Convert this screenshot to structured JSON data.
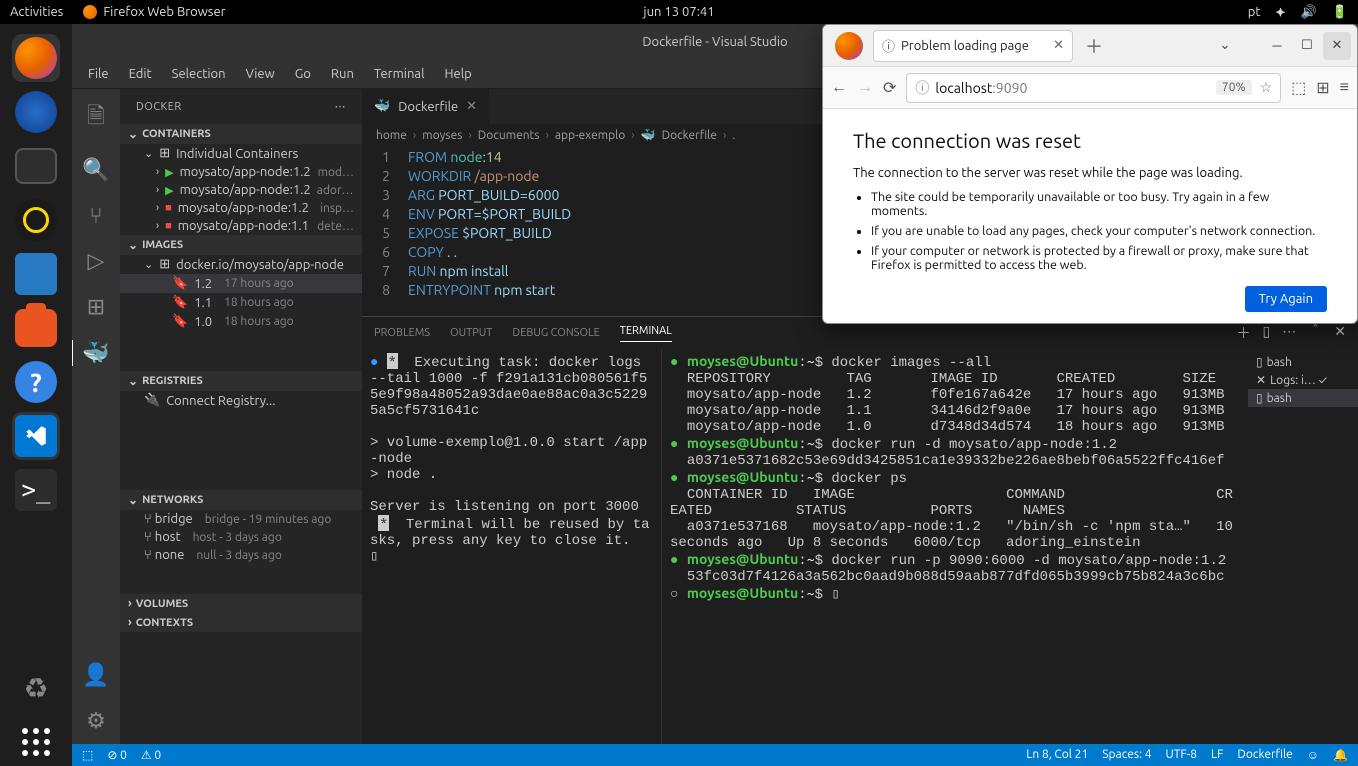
{
  "gnome": {
    "activities": "Activities",
    "app": "Firefox Web Browser",
    "clock": "jun 13  07:41",
    "lang": "pt"
  },
  "vscode": {
    "title": "Dockerfile - Visual Studio",
    "menu": [
      "File",
      "Edit",
      "Selection",
      "View",
      "Go",
      "Run",
      "Terminal",
      "Help"
    ],
    "docker_panel": {
      "title": "DOCKER",
      "sections": {
        "containers": "CONTAINERS",
        "individual": "Individual Containers",
        "images": "IMAGES",
        "registries": "REGISTRIES",
        "networks": "NETWORKS",
        "volumes": "VOLUMES",
        "contexts": "CONTEXTS"
      },
      "containers": [
        {
          "name": "moysato/app-node:1.2",
          "desc": "mod…",
          "running": true
        },
        {
          "name": "moysato/app-node:1.2",
          "desc": "adori…",
          "running": true
        },
        {
          "name": "moysato/app-node:1.2",
          "desc": "insp…",
          "running": false
        },
        {
          "name": "moysato/app-node:1.1",
          "desc": "dete…",
          "running": false
        }
      ],
      "image_repo": "docker.io/moysato/app-node",
      "image_tags": [
        {
          "tag": "1.2",
          "age": "17 hours ago",
          "selected": true
        },
        {
          "tag": "1.1",
          "age": "18 hours ago"
        },
        {
          "tag": "1.0",
          "age": "18 hours ago"
        }
      ],
      "connect_registry": "Connect Registry...",
      "networks": [
        {
          "name": "bridge",
          "desc": "bridge - 19 minutes ago"
        },
        {
          "name": "host",
          "desc": "host - 3 days ago"
        },
        {
          "name": "none",
          "desc": "null - 3 days ago"
        }
      ]
    },
    "tab": {
      "name": "Dockerfile"
    },
    "breadcrumb": [
      "home",
      "moyses",
      "Documents",
      "app-exemplo",
      "Dockerfile",
      "."
    ],
    "code_lines": [
      {
        "n": "1",
        "html": "<span class='kw'>FROM</span> <span class='fn'>node</span><span class='op'>:</span><span class='num'>14</span>"
      },
      {
        "n": "2",
        "html": "<span class='kw'>WORKDIR</span> <span class='txt'>/app-node</span>"
      },
      {
        "n": "3",
        "html": "<span class='kw'>ARG</span> <span class='var'>PORT_BUILD=6000</span>"
      },
      {
        "n": "4",
        "html": "<span class='kw'>ENV</span> <span class='var'>PORT=$PORT_BUILD</span>"
      },
      {
        "n": "5",
        "html": "<span class='kw'>EXPOSE</span> <span class='var'>$PORT_BUILD</span>"
      },
      {
        "n": "6",
        "html": "<span class='kw'>COPY</span> <span class='op'>. .</span>"
      },
      {
        "n": "7",
        "html": "<span class='kw'>RUN</span> <span class='var'>npm</span> <span class='var'>install</span>"
      },
      {
        "n": "8",
        "html": "<span class='kw'>ENTRYPOINT</span> <span class='var'>npm</span> <span class='var'>start</span>"
      }
    ],
    "panel_tabs": [
      "PROBLEMS",
      "OUTPUT",
      "DEBUG CONSOLE",
      "TERMINAL"
    ],
    "term_left": "<span class='bullet-blue'>●</span> <span class='inv'>*</span>  Executing task: docker logs --tail 1000 -f f291a131cb080561f55e9f98a48052a93dae0ae88ac0a3c52295a5cf5731641c \n\n> volume-exemplo@1.0.0 start /app-node\n> node .\n\nServer is listening on port 3000\n <span class='inv'>*</span>  Terminal will be reused by tasks, press any key to close it.\n▯",
    "term_right": "<span class='bullet-green'>●</span> <span class='prompt-user'>moyses@Ubuntu</span>:<span class='prompt-path'>~</span>$ docker images --all\n  REPOSITORY         TAG       IMAGE ID       CREATED        SIZE\n  moysato/app-node   1.2       f0fe167a642e   17 hours ago   913MB\n  moysato/app-node   1.1       34146d2f9a0e   17 hours ago   913MB\n  moysato/app-node   1.0       d7348d34d574   18 hours ago   913MB\n<span class='bullet-green'>●</span> <span class='prompt-user'>moyses@Ubuntu</span>:<span class='prompt-path'>~</span>$ docker run -d moysato/app-node:1.2\n  a0371e5371682c53e69dd3425851ca1e39332be226ae8bebf06a5522ffc416ef\n<span class='bullet-green'>●</span> <span class='prompt-user'>moyses@Ubuntu</span>:<span class='prompt-path'>~</span>$ docker ps\n  CONTAINER ID   IMAGE                  COMMAND                  CREATED          STATUS          PORTS      NAMES\n  a0371e537168   moysato/app-node:1.2   \"/bin/sh -c 'npm sta…\"   10 seconds ago   Up 8 seconds   6000/tcp   adoring_einstein\n<span class='bullet-green'>●</span> <span class='prompt-user'>moyses@Ubuntu</span>:<span class='prompt-path'>~</span>$ docker run -p 9090:6000 -d moysato/app-node:1.2\n  53fc03d7f4126a3a562bc0aad9b088d59aab877dfd065b3999cb75b824a3c6bc\n○ <span class='prompt-user'>moyses@Ubuntu</span>:<span class='prompt-path'>~</span>$ ▯",
    "term_list": [
      {
        "icon": "▯",
        "label": "bash"
      },
      {
        "icon": "✕",
        "label": "Logs: i…",
        "check": true
      },
      {
        "icon": "▯",
        "label": "bash",
        "sel": true
      }
    ],
    "status": {
      "remote": "⬚",
      "errors": "⊘ 0",
      "warnings": "⚠ 0",
      "pos": "Ln 8, Col 21",
      "spaces": "Spaces: 4",
      "enc": "UTF-8",
      "eol": "LF",
      "lang": "Dockerfile"
    }
  },
  "firefox": {
    "tab_title": "Problem loading page",
    "url_host": "localhost",
    "url_port": ":9090",
    "zoom": "70%",
    "h1": "The connection was reset",
    "p1": "The connection to the server was reset while the page was loading.",
    "bullets": [
      "The site could be temporarily unavailable or too busy. Try again in a few moments.",
      "If you are unable to load any pages, check your computer's network connection.",
      "If your computer or network is protected by a firewall or proxy, make sure that Firefox is permitted to access the web."
    ],
    "try_again": "Try Again"
  }
}
